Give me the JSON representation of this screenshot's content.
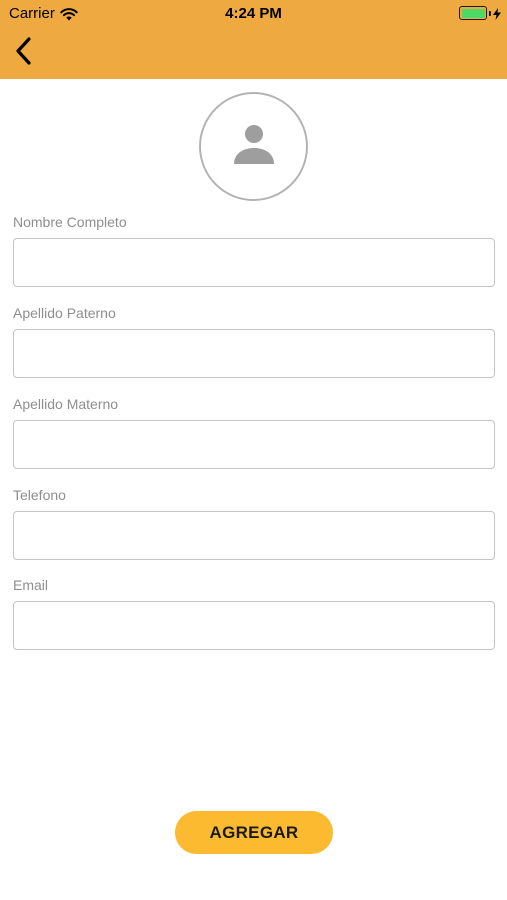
{
  "status_bar": {
    "carrier": "Carrier",
    "time": "4:24 PM",
    "wifi_icon": "wifi-icon",
    "battery_icon": "battery-icon",
    "battery_level": 1.0,
    "charging_icon": "bolt-icon"
  },
  "nav": {
    "back_icon": "chevron-left-icon"
  },
  "avatar": {
    "icon": "person-icon"
  },
  "form": {
    "fields": [
      {
        "label": "Nombre Completo",
        "value": "",
        "placeholder": ""
      },
      {
        "label": "Apellido Paterno",
        "value": "",
        "placeholder": ""
      },
      {
        "label": "Apellido Materno",
        "value": "",
        "placeholder": ""
      },
      {
        "label": "Telefono",
        "value": "",
        "placeholder": ""
      },
      {
        "label": "Email",
        "value": "",
        "placeholder": ""
      }
    ],
    "submit_label": "AGREGAR"
  },
  "colors": {
    "header_bg": "#EEA940",
    "button_bg": "#FBBA2F",
    "battery_green": "#4CD964",
    "label_gray": "#8e8e8e",
    "border_gray": "#c4c4c4"
  }
}
